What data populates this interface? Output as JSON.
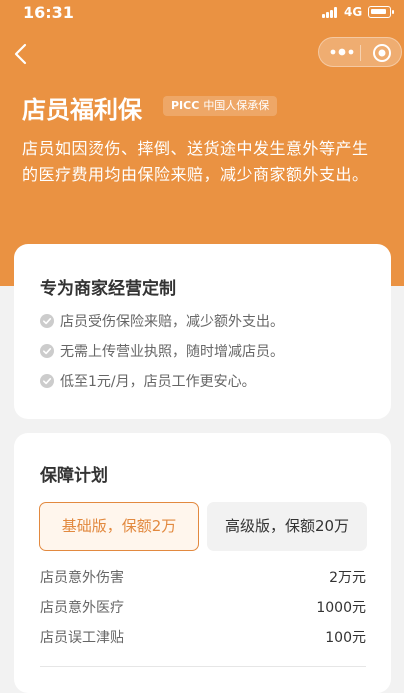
{
  "status_bar": {
    "time": "16:31",
    "network": "4G"
  },
  "header": {
    "title": "店员福利保",
    "insurer_code": "PICC",
    "insurer_name": "中国人保承保",
    "description": "店员如因烫伤、摔倒、送货途中发生意外等产生的医疗费用均由保险来赔，减少商家额外支出。"
  },
  "highlights": {
    "title": "专为商家经营定制",
    "items": [
      "店员受伤保险来赔，减少额外支出。",
      "无需上传营业执照，随时增减店员。",
      "低至1元/月，店员工作更安心。"
    ]
  },
  "plan": {
    "title": "保障计划",
    "options": [
      {
        "label": "基础版，保额2万",
        "selected": true
      },
      {
        "label": "高级版，保额20万",
        "selected": false
      }
    ],
    "coverage": [
      {
        "name": "店员意外伤害",
        "amount": "2万元"
      },
      {
        "name": "店员意外医疗",
        "amount": "1000元"
      },
      {
        "name": "店员误工津贴",
        "amount": "100元"
      }
    ]
  },
  "colors": {
    "brand": "#ea9242",
    "accent": "#e2893f",
    "check": "#cccccc"
  }
}
